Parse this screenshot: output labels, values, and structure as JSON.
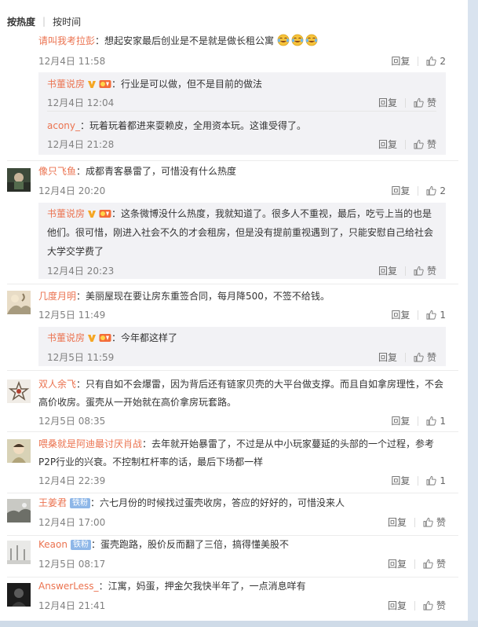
{
  "sort": {
    "hot": "按热度",
    "time": "按时间"
  },
  "icons": {
    "like": "thumbs-up-icon",
    "verified": "verified-v-badge-icon",
    "emoji": "laughing-tears-emoji-icon"
  },
  "colors": {
    "username": "#eb7350",
    "sub_bg": "#f2f2f5",
    "meta": "#808080"
  },
  "comments": [
    {
      "user": "请叫我考拉彭",
      "text": "想起安家最后创业是不是就是做长租公寓",
      "time": "12月4日 11:58",
      "reply": "回复",
      "likes": "2",
      "replies": [
        {
          "user": "书董说房",
          "text": "行业是可以做，但不是目前的做法",
          "time": "12月4日 12:04",
          "reply": "回复",
          "likes": "赞"
        },
        {
          "user": "acony_",
          "text": "玩着玩着都进来耍赖皮，全用资本玩。这谁受得了。",
          "time": "12月4日 21:28",
          "reply": "回复",
          "likes": "赞"
        }
      ]
    },
    {
      "user": "像只飞鱼",
      "text": "成都青客暴雷了，可惜没有什么热度",
      "time": "12月4日 20:20",
      "reply": "回复",
      "likes": "2",
      "replies": [
        {
          "user": "书董说房",
          "text_lines": [
            "这条微博没什么热度，我就知道了。很多人不重视，最后，吃亏上当的也是",
            "他们。很可惜，刚进入社会不久的才会租房，但是没有提前重视遇到了，只能安慰自己给社会",
            "大学交学费了"
          ],
          "time": "12月4日 20:23",
          "reply": "回复",
          "likes": "赞"
        }
      ]
    },
    {
      "user": "几度月明",
      "text": "美丽屋现在要让房东重签合同，每月降500，不签不给钱。",
      "time": "12月5日 11:49",
      "reply": "回复",
      "likes": "1",
      "replies": [
        {
          "user": "书董说房",
          "text": "今年都这样了",
          "time": "12月5日 11:59",
          "reply": "回复",
          "likes": "赞"
        }
      ]
    },
    {
      "user": "双人余飞",
      "text_lines": [
        "只有自如不会爆雷，因为背后还有链家贝壳的大平台做支撑。而且自如拿房理性，不会",
        "高价收房。蛋壳从一开始就在高价拿房玩套路。"
      ],
      "time": "12月5日 08:35",
      "reply": "回复",
      "likes": "1"
    },
    {
      "user": "喂桑就是阿迪最讨厌肖战",
      "text_lines": [
        "去年就开始暴雷了，不过是从中小玩家蔓延的头部的一个过程，参考",
        "P2P行业的兴衰。不控制杠杆率的话，最后下场都一样"
      ],
      "time": "12月4日 22:39",
      "reply": "回复",
      "likes": "1"
    },
    {
      "user": "王姜君",
      "badge": "铁粉",
      "text": "六七月份的时候找过蛋壳收房，答应的好好的，可惜没来人",
      "time": "12月4日 17:00",
      "reply": "回复",
      "likes": "赞"
    },
    {
      "user": "Keaon",
      "badge": "铁粉",
      "text": "蛋壳跑路，股价反而翻了三倍，搞得懂美股不",
      "time": "12月5日 08:17",
      "reply": "回复",
      "likes": "赞"
    },
    {
      "user": "AnswerLess_",
      "text": "江寓，妈蛋，押金欠我快半年了，一点消息咩有",
      "time": "12月4日 21:41",
      "reply": "回复",
      "likes": "赞"
    }
  ]
}
